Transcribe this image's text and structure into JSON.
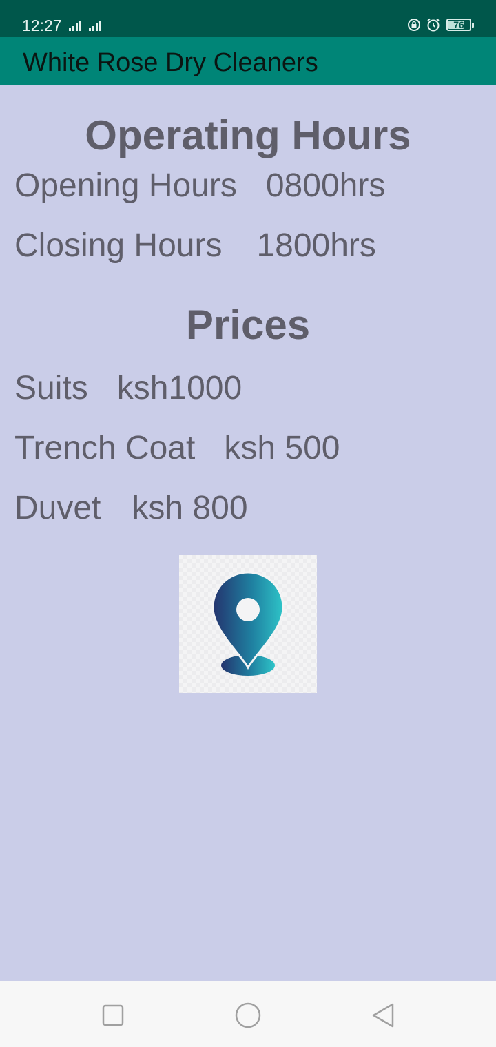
{
  "status_bar": {
    "time": "12:27",
    "battery_level": "76",
    "icons": [
      "signal-icon",
      "signal-icon",
      "rotation-lock-icon",
      "alarm-icon",
      "battery-icon"
    ]
  },
  "app_bar": {
    "title": "White Rose Dry Cleaners",
    "color": "#008577"
  },
  "operating_hours": {
    "heading": "Operating Hours",
    "opening": {
      "label": "Opening Hours",
      "value": "0800hrs"
    },
    "closing": {
      "label": "Closing Hours",
      "value": "1800hrs"
    }
  },
  "prices": {
    "heading": "Prices",
    "items": [
      {
        "name": "Suits",
        "price": "ksh1000"
      },
      {
        "name": "Trench Coat",
        "price": "ksh 500"
      },
      {
        "name": "Duvet",
        "price": "ksh 800"
      }
    ]
  },
  "location_image": {
    "icon": "location-pin-icon"
  },
  "nav_bar": {
    "buttons": [
      "recent-apps-button",
      "home-button",
      "back-button"
    ]
  },
  "colors": {
    "background": "#cacde8",
    "status_bar": "#00574b",
    "text": "#5f5e6a"
  }
}
